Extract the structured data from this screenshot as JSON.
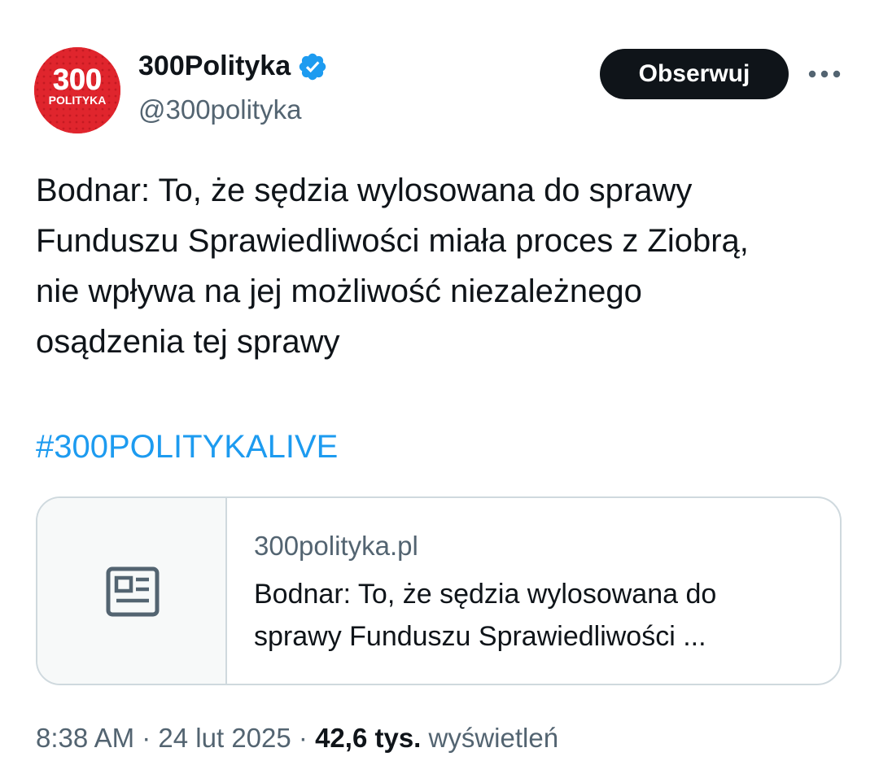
{
  "author": {
    "display_name": "300Polityka",
    "handle": "@300polityka",
    "verified": true,
    "avatar_text_main": "300",
    "avatar_text_sub": "POLITYKA",
    "avatar_color": "#e0252d"
  },
  "actions": {
    "follow_label": "Obserwuj",
    "more_icon": "more-horizontal-icon"
  },
  "tweet": {
    "text_lines": [
      "Bodnar: To, że sędzia wylosowana do sprawy",
      "Funduszu Sprawiedliwości miała proces z Ziobrą,",
      "nie wpływa na jej możliwość niezależnego",
      "osądzenia tej sprawy"
    ],
    "hashtag": "#300POLITYKALIVE"
  },
  "link_card": {
    "icon": "news-article-icon",
    "domain": "300polityka.pl",
    "title_lines": [
      "Bodnar: To, że sędzia wylosowana do",
      "sprawy Funduszu Sprawiedliwości ..."
    ]
  },
  "meta": {
    "time": "8:38 AM",
    "separator": "·",
    "date": "24 lut 2025",
    "views_count": "42,6 tys.",
    "views_label": "wyświetleń"
  },
  "colors": {
    "text": "#0f1419",
    "secondary": "#536471",
    "link": "#1d9bf0",
    "border": "#cfd9de",
    "verified": "#1d9bf0"
  }
}
